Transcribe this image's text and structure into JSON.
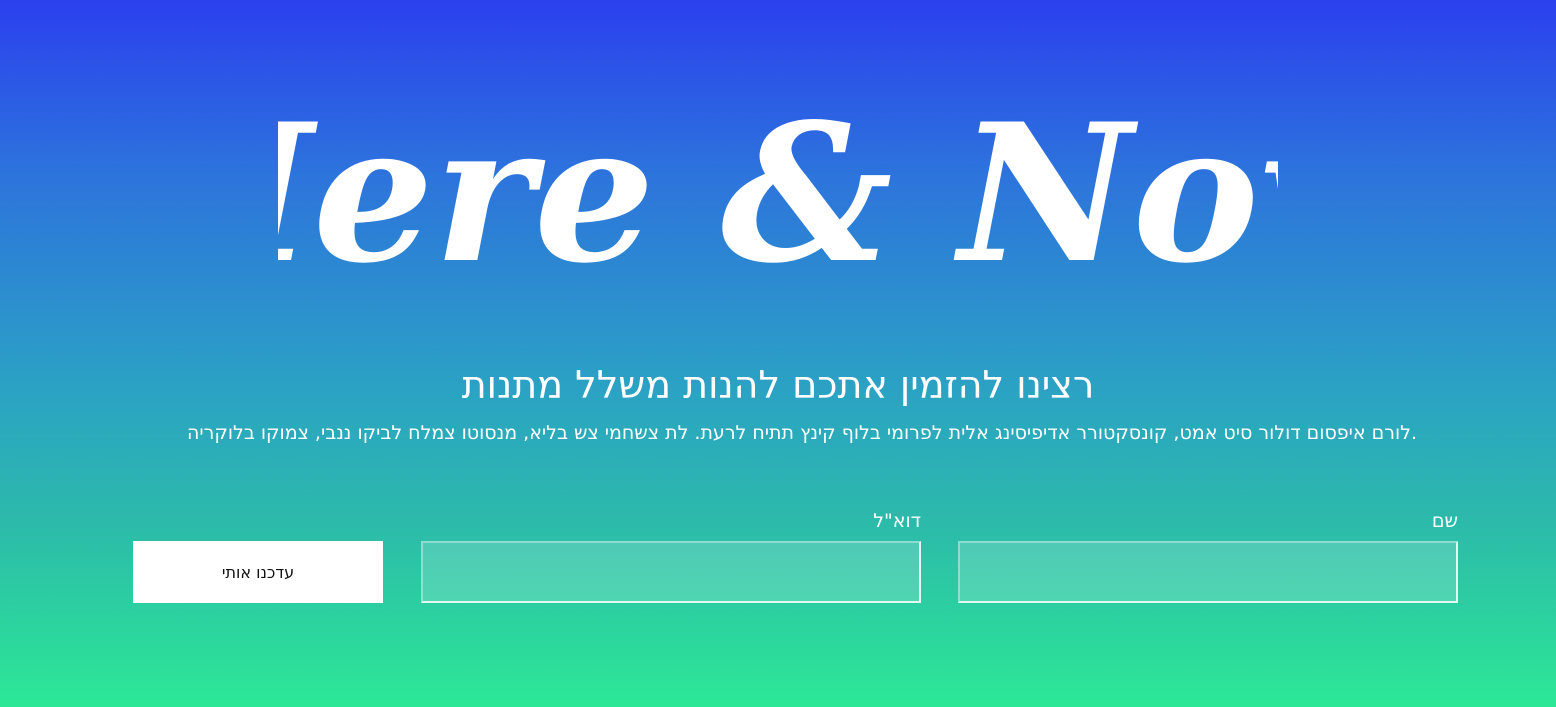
{
  "hero": {
    "logo_text": "Here & Now",
    "headline": "רצינו להזמין אתכם להנות משלל מתנות",
    "description": ".לורם איפסום דולור סיט אמט, קונסקטורר אדיפיסינג אלית לפרומי בלוף קינץ תתיח לרעת. לת צשחמי צש בליא, מנסוטו צמלח לביקו ננבי, צמוקו בלוקריה"
  },
  "form": {
    "name_label": "שם",
    "name_value": "",
    "email_label": "דוא\"ל",
    "email_value": "",
    "submit_label": "עדכנו אותי"
  },
  "colors": {
    "gradient_top": "#2b40ef",
    "gradient_bottom": "#2ce896",
    "text": "#ffffff",
    "button_bg": "#ffffff",
    "button_text": "#111111"
  }
}
